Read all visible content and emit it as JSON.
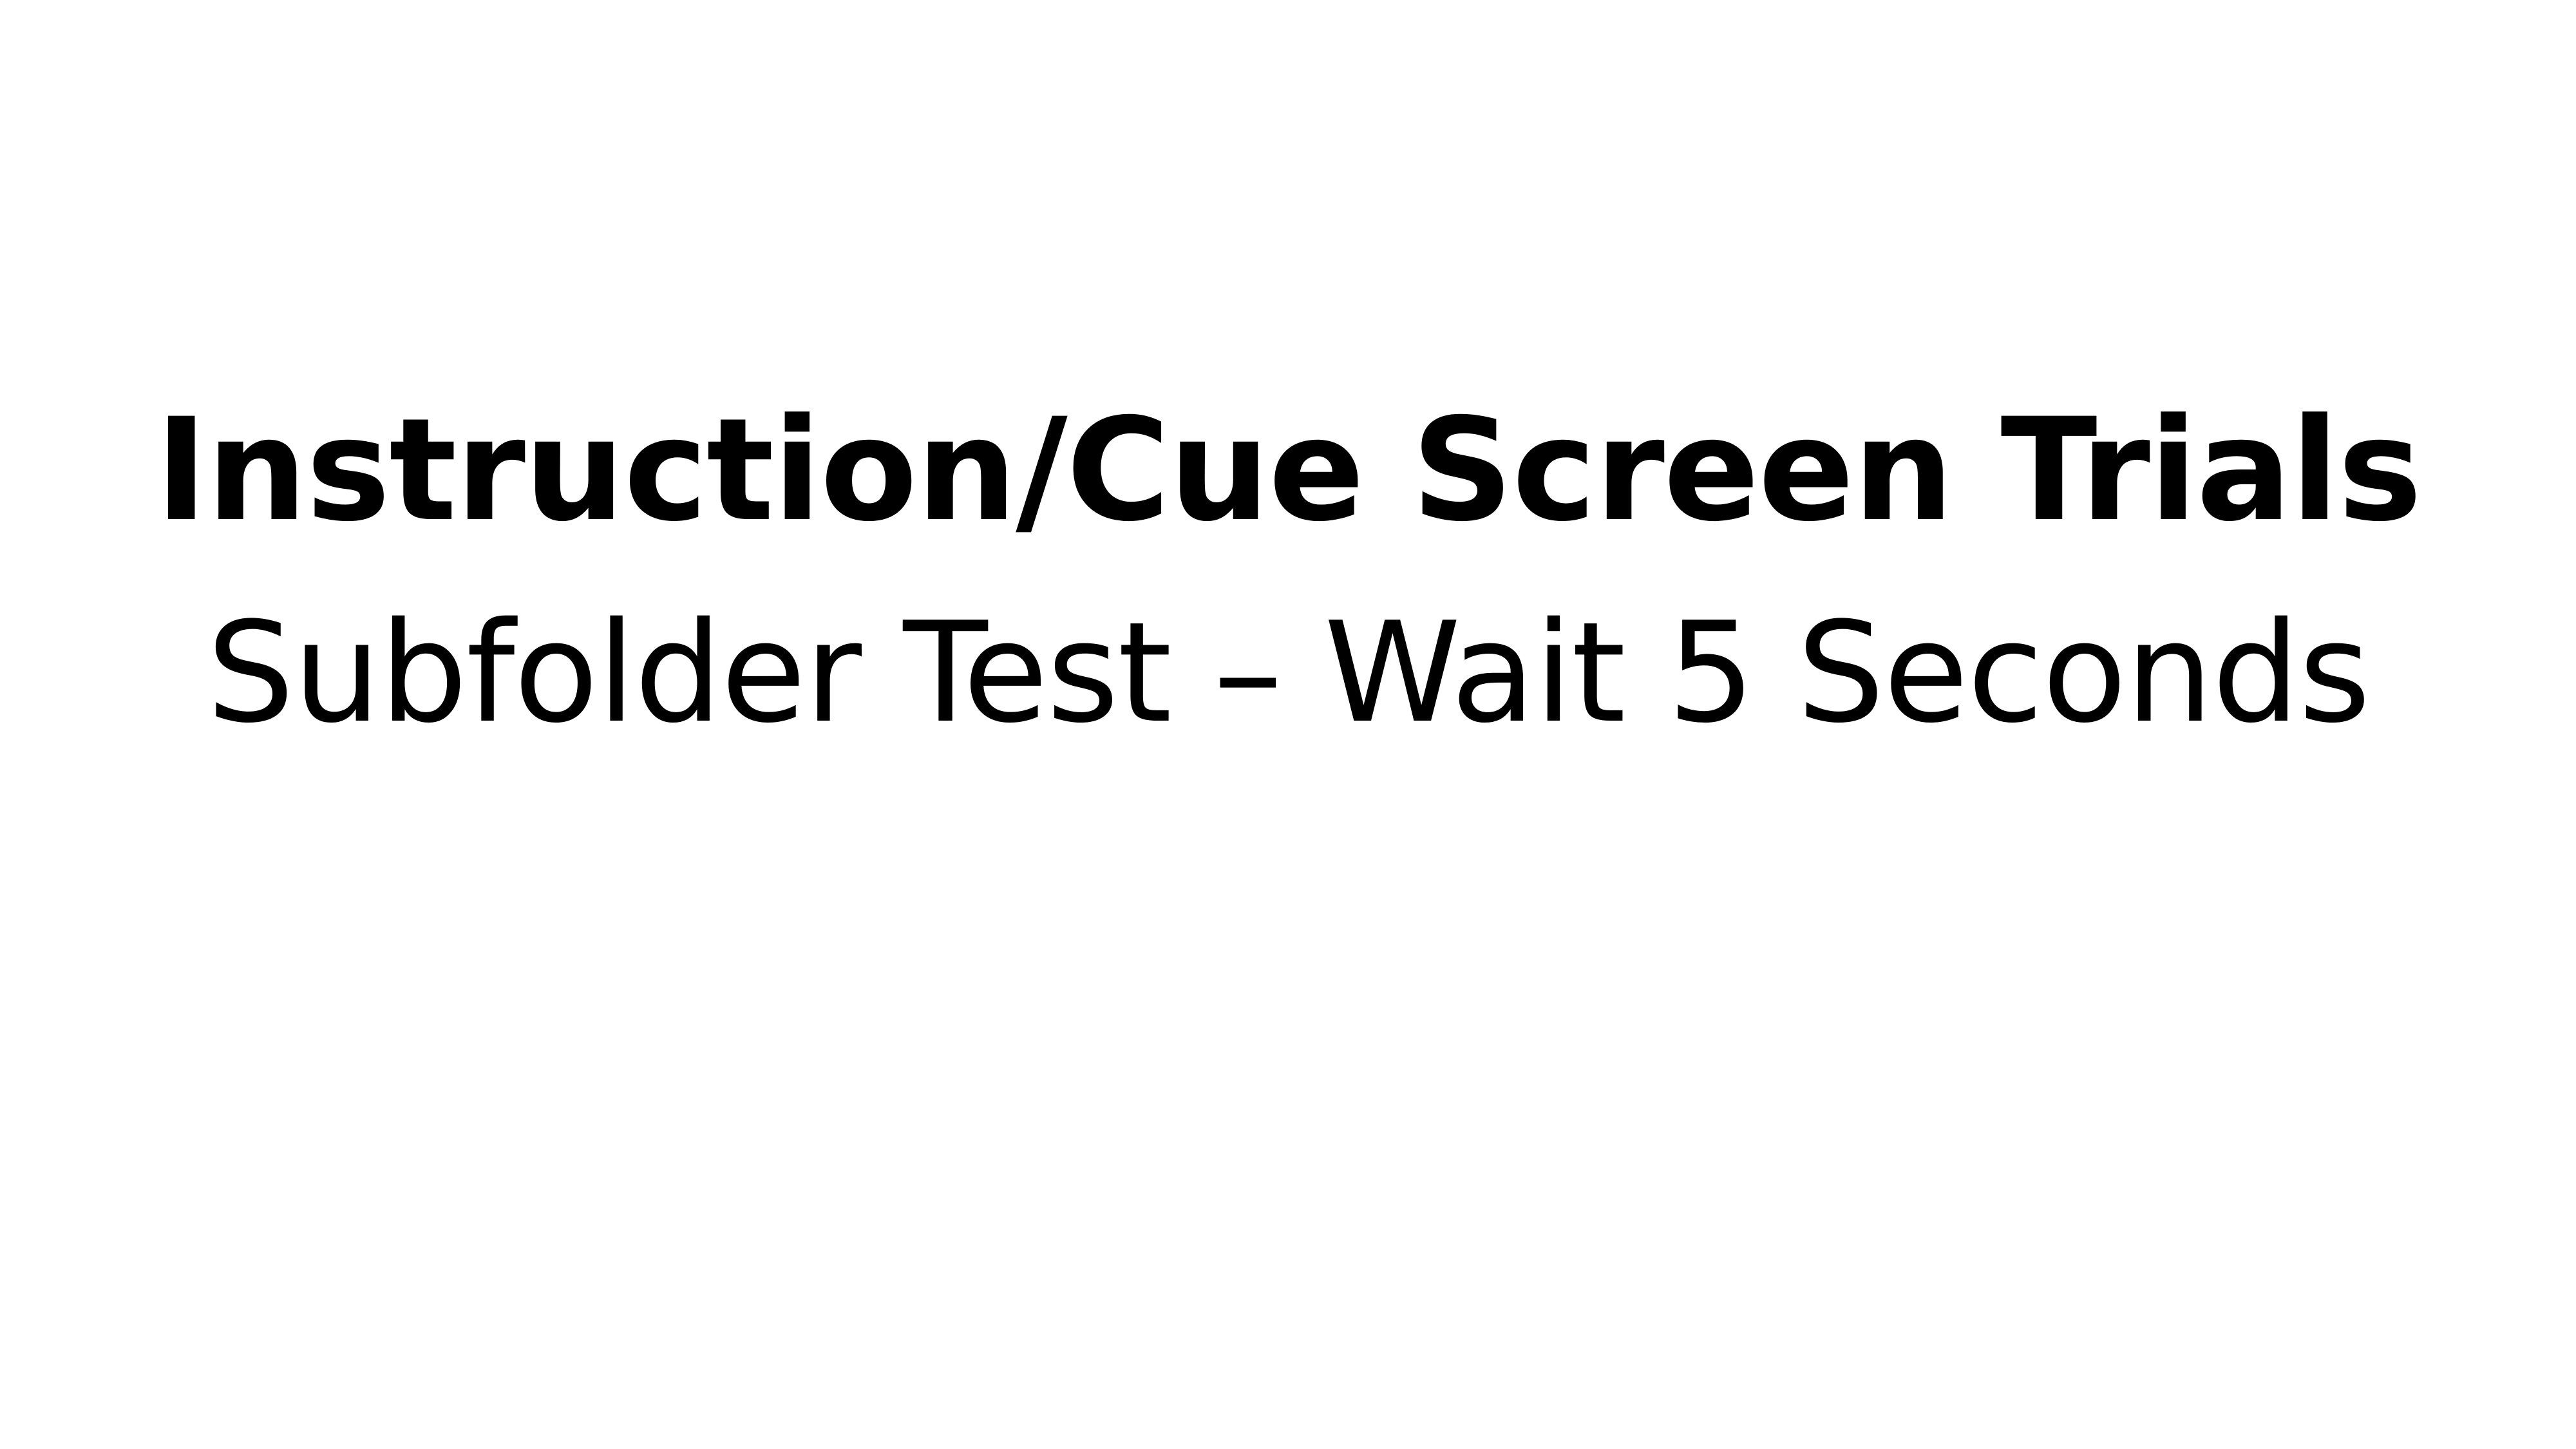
{
  "slide": {
    "title": "Instruction/Cue Screen Trials",
    "subtitle": "Subfolder Test – Wait 5 Seconds"
  },
  "colors": {
    "background": "#ffffff",
    "text": "#000000"
  }
}
